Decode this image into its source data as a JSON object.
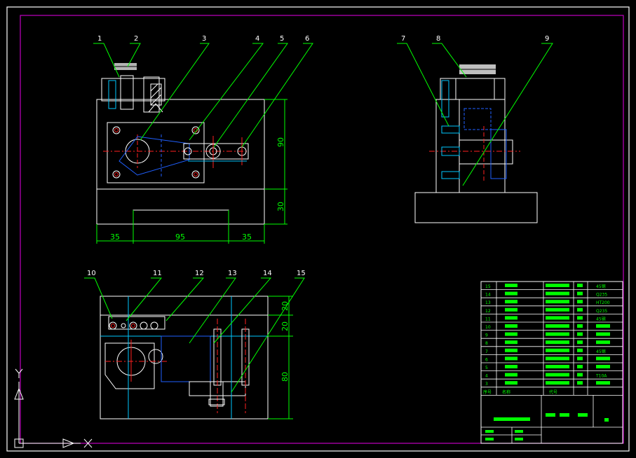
{
  "colors": {
    "background": "#000000",
    "outline": "#ffffff",
    "frame": "#c000c0",
    "dimension": "#00ff00",
    "center": "#ff2020",
    "hidden": "#2060ff",
    "aux": "#00c8ff",
    "hatch": "#ffffff",
    "table_text": "#00ff00"
  },
  "callouts_front": [
    "1",
    "2",
    "3",
    "4",
    "5",
    "6"
  ],
  "callouts_side": [
    "7",
    "8",
    "9"
  ],
  "callouts_plan": [
    "10",
    "11",
    "12",
    "13",
    "14",
    "15"
  ],
  "dims": {
    "front_height_upper": "90",
    "front_height_lower": "30",
    "front_width_left": "35",
    "front_width_mid": "95",
    "front_width_right": "35",
    "plan_top_1": "20",
    "plan_top_2": "20",
    "plan_height": "80"
  },
  "bom_rows": [
    {
      "no": "15",
      "qty": "",
      "mat": "45钢"
    },
    {
      "no": "14",
      "qty": "1",
      "mat": "Q235"
    },
    {
      "no": "13",
      "qty": "",
      "mat": "HT200"
    },
    {
      "no": "12",
      "qty": "",
      "mat": "Q235"
    },
    {
      "no": "11",
      "qty": "",
      "mat": "45钢"
    },
    {
      "no": "10",
      "qty": "",
      "mat": ""
    },
    {
      "no": "9",
      "qty": "",
      "mat": ""
    },
    {
      "no": "8",
      "qty": "",
      "mat": ""
    },
    {
      "no": "7",
      "qty": "",
      "mat": "45钢"
    },
    {
      "no": "6",
      "qty": "",
      "mat": ""
    },
    {
      "no": "5",
      "qty": "",
      "mat": ""
    },
    {
      "no": "4",
      "qty": "",
      "mat": "T10A"
    },
    {
      "no": "3",
      "qty": "",
      "mat": ""
    }
  ],
  "bom_header": {
    "no": "序号",
    "name": "名称",
    "code": "代号"
  },
  "axis": {
    "y": "Y",
    "x": "X"
  }
}
